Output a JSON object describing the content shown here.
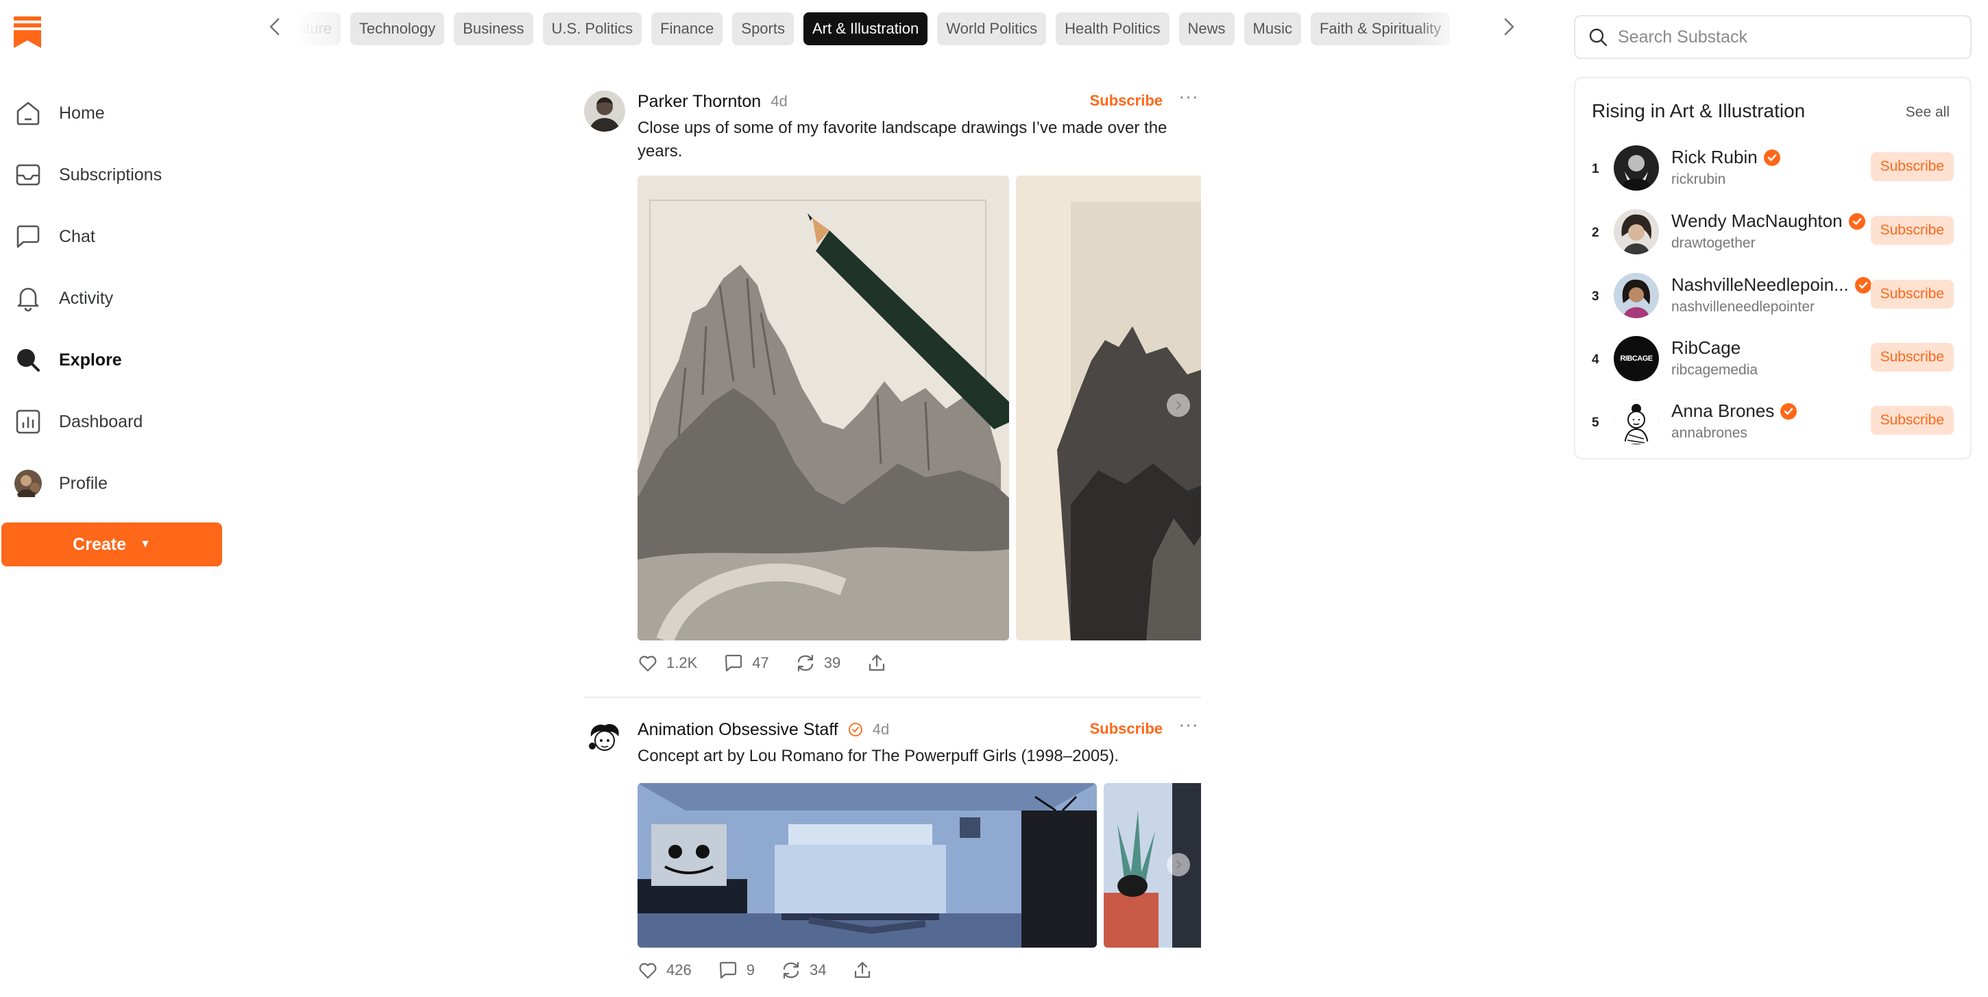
{
  "brand": {
    "accent": "#FF6719",
    "accent_light": "#FFE1D1"
  },
  "sidebar": {
    "logo_icon": "substack-logo-icon",
    "items": [
      {
        "label": "Home",
        "icon": "home-icon"
      },
      {
        "label": "Subscriptions",
        "icon": "inbox-icon"
      },
      {
        "label": "Chat",
        "icon": "chat-icon"
      },
      {
        "label": "Activity",
        "icon": "bell-icon"
      },
      {
        "label": "Explore",
        "icon": "search-icon",
        "active": true
      },
      {
        "label": "Dashboard",
        "icon": "bar-chart-icon"
      },
      {
        "label": "Profile",
        "icon": "avatar"
      }
    ],
    "create_label": "Create"
  },
  "categories": {
    "items": [
      "Culture",
      "Technology",
      "Business",
      "U.S. Politics",
      "Finance",
      "Sports",
      "Art & Illustration",
      "World Politics",
      "Health Politics",
      "News",
      "Music",
      "Faith & Spirituality"
    ],
    "active": "Art & Illustration"
  },
  "search": {
    "placeholder": "Search Substack"
  },
  "posts": [
    {
      "author": "Parker Thornton",
      "time": "4d",
      "subscribe_label": "Subscribe",
      "more_label": "···",
      "text": "Close ups of some of my favorite landscape drawings I’ve made over the years.",
      "likes": "1.2K",
      "comments": "47",
      "restacks": "39"
    },
    {
      "author": "Animation Obsessive Staff",
      "time": "4d",
      "subscribe_label": "Subscribe",
      "more_label": "···",
      "text": "Concept art by Lou Romano for The Powerpuff Girls (1998–2005).",
      "likes": "426",
      "comments": "9",
      "restacks": "34"
    }
  ],
  "rising": {
    "title": "Rising in Art & Illustration",
    "see_all": "See all",
    "subscribe_label": "Subscribe",
    "items": [
      {
        "rank": "1",
        "name": "Rick Rubin",
        "handle": "rickrubin",
        "verified": true
      },
      {
        "rank": "2",
        "name": "Wendy MacNaughton",
        "handle": "drawtogether",
        "verified": true
      },
      {
        "rank": "3",
        "name": "NashvilleNeedlepoin...",
        "handle": "nashvilleneedlepointer",
        "verified": true
      },
      {
        "rank": "4",
        "name": "RibCage",
        "handle": "ribcagemedia",
        "verified": false,
        "avatar_text": "RIBCAGE"
      },
      {
        "rank": "5",
        "name": "Anna Brones",
        "handle": "annabrones",
        "verified": true
      }
    ]
  }
}
